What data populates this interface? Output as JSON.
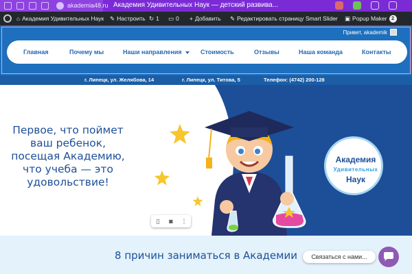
{
  "browser": {
    "domain": "akademia48.ru",
    "title": "Академия Удивительных Наук — детский развива..."
  },
  "admin_bar": {
    "site_name": "Академия Удивительных Наук",
    "customize": "Настроить",
    "comments_count": "1",
    "comments_pending": "0",
    "add_new": "Добавить",
    "edit_page": "Редактировать страницу",
    "smart_slider": "Smart Slider",
    "popup_maker": "Popup Maker",
    "popup_count": "2"
  },
  "header": {
    "greeting": "Привет, akademik",
    "nav": [
      {
        "label": "Главная"
      },
      {
        "label": "Почему мы"
      },
      {
        "label": "Наши направления"
      },
      {
        "label": "Стоимость"
      },
      {
        "label": "Отзывы"
      },
      {
        "label": "Наша команда"
      },
      {
        "label": "Контакты"
      }
    ]
  },
  "contact_bar": {
    "address1": "г. Липецк, ул. Желябова, 14",
    "address2": "г. Липецк, ул. Титова, 5",
    "phone": "Телефон: (4742) 200-128"
  },
  "hero": {
    "headline": "Первое, что поймет ваш ребенок, посещая Академию, что учеба — это удовольствие!",
    "logo": {
      "line1": "Академия",
      "line2": "Удивительных",
      "line3": "Наук"
    }
  },
  "reasons": {
    "title": "8 причин заниматься в Академии"
  },
  "chat": {
    "label": "Связаться с нами..."
  },
  "colors": {
    "brand_blue": "#1e6fbd",
    "nav_text": "#2a6ab0",
    "browser_purple": "#7b2bd6",
    "chat_purple": "#8e5ab4"
  }
}
